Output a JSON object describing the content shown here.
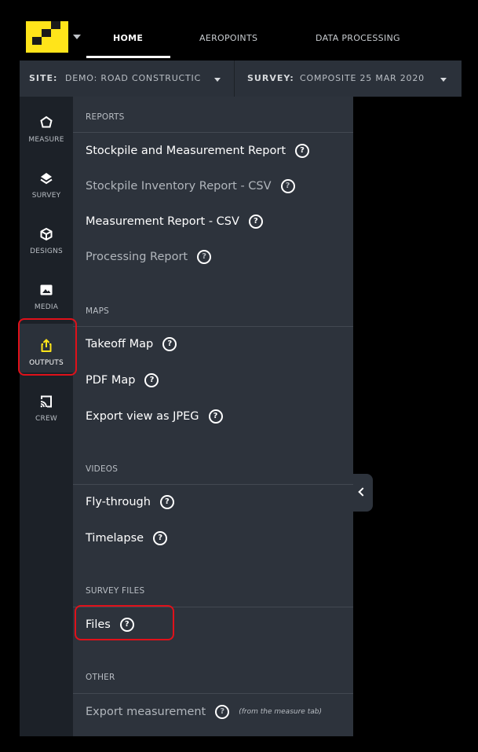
{
  "nav": {
    "tabs": [
      {
        "label": "HOME"
      },
      {
        "label": "AEROPOINTS"
      },
      {
        "label": "DATA PROCESSING"
      }
    ]
  },
  "sitebar": {
    "site_label": "SITE:",
    "site_value": "DEMO: ROAD CONSTRUCTIC",
    "survey_label": "SURVEY:",
    "survey_value": "COMPOSITE 25 MAR 2020"
  },
  "rail": {
    "items": [
      {
        "label": "MEASURE",
        "icon": "hexagon-icon"
      },
      {
        "label": "SURVEY",
        "icon": "layers-icon"
      },
      {
        "label": "DESIGNS",
        "icon": "cube-icon"
      },
      {
        "label": "MEDIA",
        "icon": "image-icon"
      },
      {
        "label": "OUTPUTS",
        "icon": "share-icon"
      },
      {
        "label": "CREW",
        "icon": "cast-icon"
      }
    ],
    "accent_color": "#ffe41a"
  },
  "panel": {
    "sections": {
      "reports": "REPORTS",
      "maps": "MAPS",
      "videos": "VIDEOS",
      "survey_files": "SURVEY FILES",
      "other": "OTHER"
    },
    "items": {
      "stockpile_report": "Stockpile and Measurement Report",
      "stockpile_csv": "Stockpile Inventory Report - CSV",
      "measurement_csv": "Measurement Report - CSV",
      "processing_report": "Processing Report",
      "takeoff_map": "Takeoff Map",
      "pdf_map": "PDF Map",
      "export_jpeg": "Export view as JPEG",
      "fly_through": "Fly-through",
      "timelapse": "Timelapse",
      "files": "Files",
      "export_measurement": "Export measurement",
      "export_measurement_note": "(from the measure tab)"
    },
    "help_glyph": "?"
  },
  "highlight_color": "#e0111a"
}
